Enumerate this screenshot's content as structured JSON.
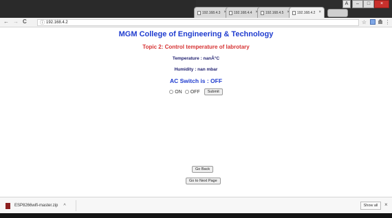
{
  "tabs": [
    {
      "title": "192.168.4.3",
      "close": "×",
      "active": false
    },
    {
      "title": "192.168.4.4",
      "close": "×",
      "active": false
    },
    {
      "title": "192.168.4.5",
      "close": "×",
      "active": false
    },
    {
      "title": "192.168.4.2",
      "close": "×",
      "active": true
    }
  ],
  "window_controls": {
    "minimize": "–",
    "maximize": "□",
    "close": "×",
    "user": "A"
  },
  "toolbar": {
    "back": "←",
    "forward": "→",
    "reload": "C",
    "info": "ⓘ",
    "url": "192.168.4.2",
    "star": "☆",
    "menu": "⋮"
  },
  "page": {
    "college": "MGM College of Engineering & Technology",
    "topic": "Topic 2: Control temperature of labrotary",
    "temperature": "Temperature : nanÂ°C",
    "humidity": "Humidity : nan mbar",
    "ac_status": "AC Switch is : OFF",
    "radio_on": "ON",
    "radio_off": "OFF",
    "submit": "Submit",
    "go_back": "Go Back",
    "go_next": "Go to Next Page"
  },
  "download": {
    "filename": "ESP8266wifi-master.zip",
    "caret": "^",
    "show_all": "Show all",
    "close": "×"
  }
}
